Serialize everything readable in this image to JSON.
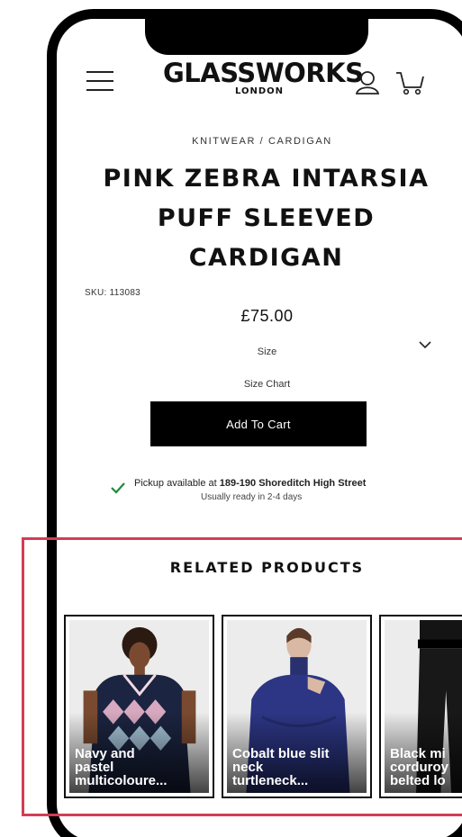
{
  "header": {
    "logo_main": "GLASSWORKS",
    "logo_sub": "LONDON",
    "menu_icon": "hamburger-menu-icon",
    "account_icon": "user-account-icon",
    "cart_icon": "shopping-cart-icon"
  },
  "product": {
    "breadcrumb": "KNITWEAR / CARDIGAN",
    "title": "PINK ZEBRA INTARSIA PUFF SLEEVED CARDIGAN",
    "sku": "SKU: 113083",
    "price": "£75.00",
    "size_label": "Size",
    "size_chart": "Size Chart",
    "add_to_cart": "Add To Cart"
  },
  "pickup": {
    "prefix": "Pickup available at ",
    "location": "189-190 Shoreditch High Street",
    "note": "Usually ready in 2-4 days",
    "status_color": "#1f8a3c"
  },
  "related": {
    "title": "RELATED PRODUCTS",
    "items": [
      {
        "name": "Navy and\npastel\nmulticoloure..."
      },
      {
        "name": "Cobalt blue slit\nneck\nturtleneck..."
      },
      {
        "name": "Black mi\ncorduroy\nbelted lo"
      }
    ]
  },
  "colors": {
    "accent": "#000000",
    "highlight": "#d43b55"
  }
}
